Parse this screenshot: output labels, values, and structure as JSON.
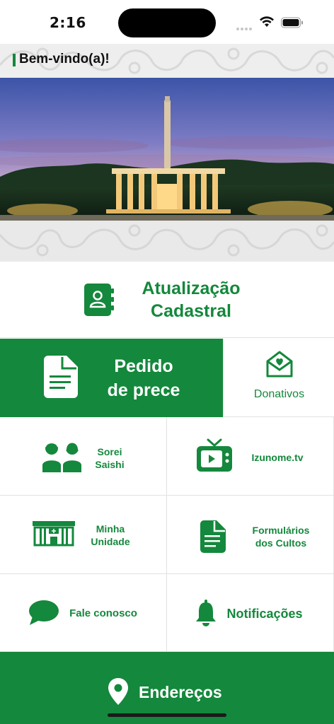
{
  "status_bar": {
    "time": "2:16"
  },
  "header": {
    "welcome": "Bem-vindo(a)!"
  },
  "menu": {
    "atualizacao": {
      "line1": "Atualização",
      "line2": "Cadastral"
    },
    "pedido": {
      "line1": "Pedido",
      "line2": "de prece"
    },
    "donativos": "Donativos",
    "sorei": {
      "line1": "Sorei",
      "line2": "Saishi"
    },
    "izunome": "Izunome.tv",
    "minha_unidade": {
      "line1": "Minha",
      "line2": "Unidade"
    },
    "formularios": {
      "line1": "Formulários",
      "line2": "dos Cultos"
    },
    "fale": "Fale conosco",
    "notificacoes": "Notificações",
    "enderecos": "Endereços"
  },
  "colors": {
    "accent": "#14883c",
    "background": "#ffffff",
    "pattern": "#e9e9e9"
  },
  "icons": {
    "atualizacao": "address-book-icon",
    "pedido": "document-icon",
    "donativos": "heart-envelope-icon",
    "sorei": "people-icon",
    "izunome": "tv-icon",
    "minha_unidade": "temple-icon",
    "formularios": "form-document-icon",
    "fale": "chat-bubble-icon",
    "notificacoes": "bell-icon",
    "enderecos": "location-pin-icon"
  }
}
